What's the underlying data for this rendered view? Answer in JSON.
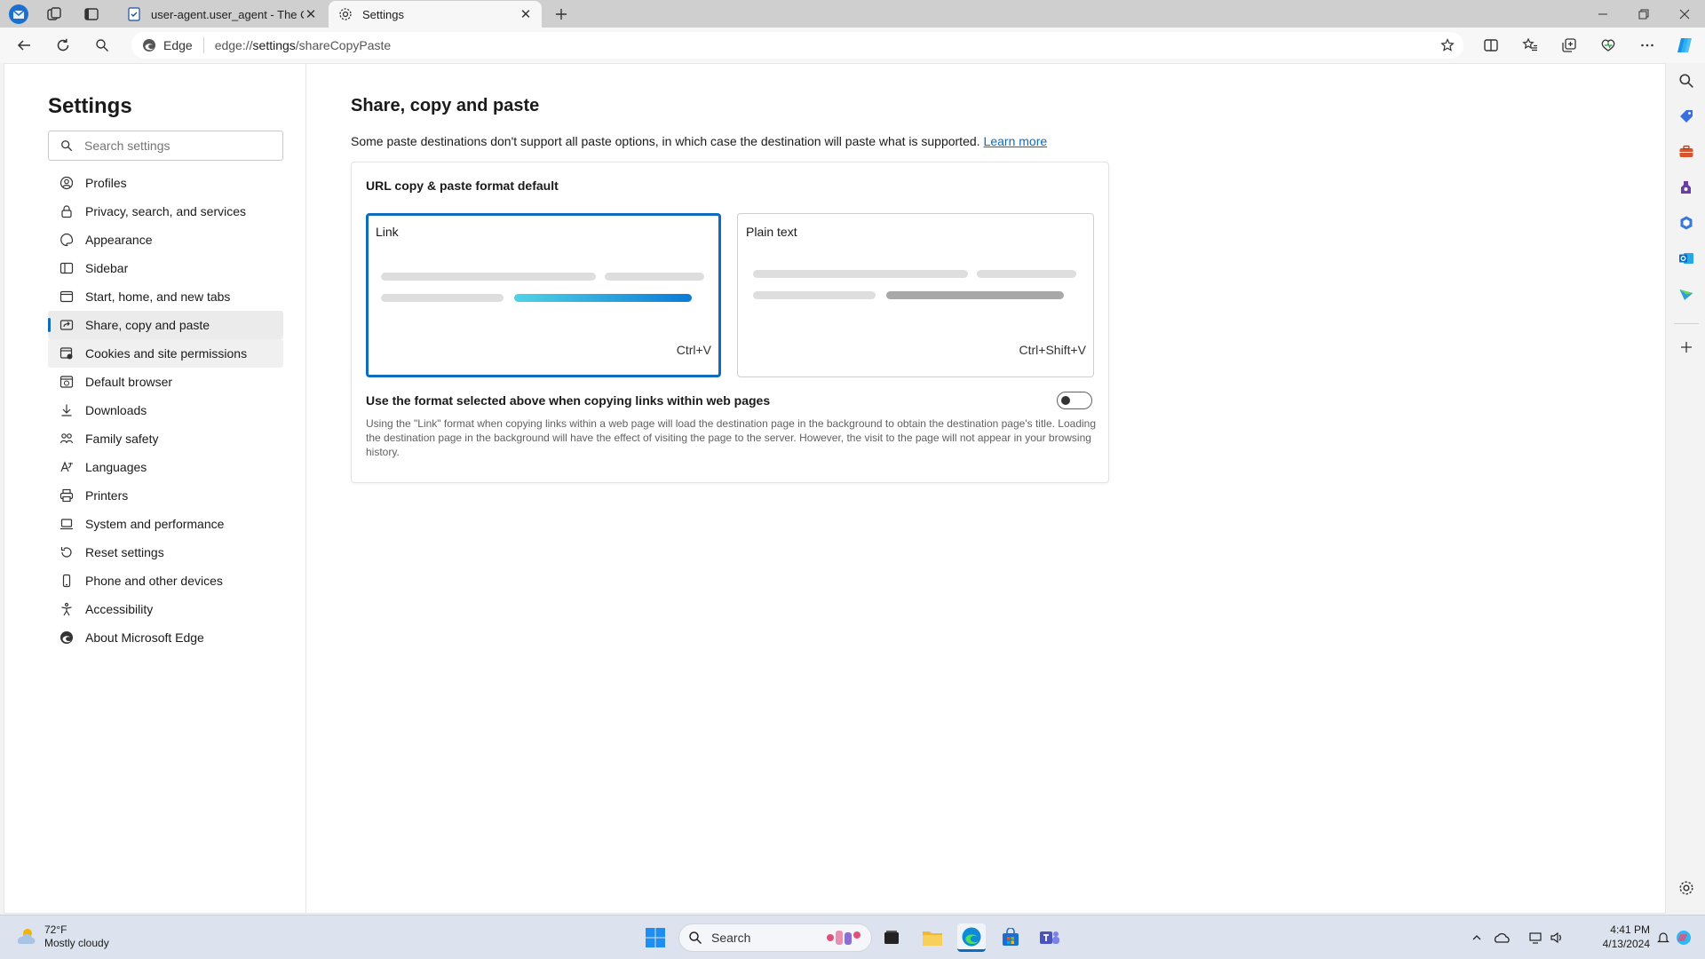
{
  "tabs": [
    {
      "title": "user-agent.user_agent - The Coll",
      "active": false
    },
    {
      "title": "Settings",
      "active": true
    }
  ],
  "address": {
    "brand": "Edge",
    "url_prefix": "edge://",
    "url_host": "settings",
    "url_path": "/shareCopyPaste"
  },
  "sidebar": {
    "title": "Settings",
    "search_placeholder": "Search settings",
    "items": [
      {
        "label": "Profiles",
        "icon": "profile-icon"
      },
      {
        "label": "Privacy, search, and services",
        "icon": "lock-icon"
      },
      {
        "label": "Appearance",
        "icon": "appearance-icon"
      },
      {
        "label": "Sidebar",
        "icon": "sidebar-icon"
      },
      {
        "label": "Start, home, and new tabs",
        "icon": "home-icon"
      },
      {
        "label": "Share, copy and paste",
        "icon": "share-icon"
      },
      {
        "label": "Cookies and site permissions",
        "icon": "cookie-icon"
      },
      {
        "label": "Default browser",
        "icon": "browser-icon"
      },
      {
        "label": "Downloads",
        "icon": "download-icon"
      },
      {
        "label": "Family safety",
        "icon": "family-icon"
      },
      {
        "label": "Languages",
        "icon": "language-icon"
      },
      {
        "label": "Printers",
        "icon": "printer-icon"
      },
      {
        "label": "System and performance",
        "icon": "laptop-icon"
      },
      {
        "label": "Reset settings",
        "icon": "reset-icon"
      },
      {
        "label": "Phone and other devices",
        "icon": "phone-icon"
      },
      {
        "label": "Accessibility",
        "icon": "accessibility-icon"
      },
      {
        "label": "About Microsoft Edge",
        "icon": "edge-icon"
      }
    ]
  },
  "main": {
    "title": "Share, copy and paste",
    "description": "Some paste destinations don't support all paste options, in which case the destination will paste what is supported.",
    "learn_more": "Learn more",
    "card": {
      "title": "URL copy & paste format default",
      "link_label": "Link",
      "link_shortcut": "Ctrl+V",
      "plain_label": "Plain text",
      "plain_shortcut": "Ctrl+Shift+V",
      "selected": "Link",
      "toggle_label": "Use the format selected above when copying links within web pages",
      "toggle_on": false,
      "toggle_desc": "Using the \"Link\" format when copying links within a web page will load the destination page in the background to obtain the destination page's title. Loading the destination page in the background will have the effect of visiting the page to the server. However, the visit to the page will not appear in your browsing history."
    }
  },
  "taskbar": {
    "weather_temp": "72°F",
    "weather_desc": "Mostly cloudy",
    "search_label": "Search",
    "time": "4:41 PM",
    "date": "4/13/2024"
  },
  "colors": {
    "accent": "#0f6cbd",
    "link_bar_start": "#4fd3e6",
    "link_bar_end": "#0a7bd6"
  }
}
